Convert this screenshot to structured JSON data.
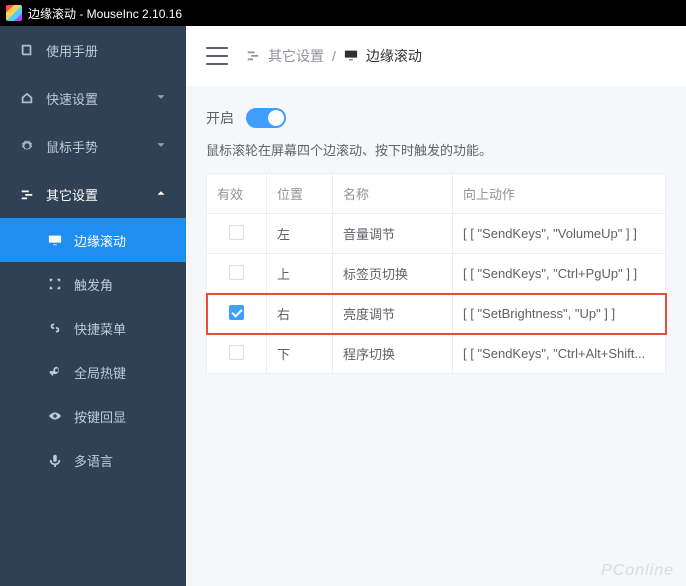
{
  "window": {
    "title": "边缘滚动 - MouseInc 2.10.16"
  },
  "sidebar": {
    "items": [
      {
        "label": "使用手册"
      },
      {
        "label": "快速设置"
      },
      {
        "label": "鼠标手势"
      }
    ],
    "group": {
      "label": "其它设置",
      "children": [
        {
          "label": "边缘滚动"
        },
        {
          "label": "触发角"
        },
        {
          "label": "快捷菜单"
        },
        {
          "label": "全局热键"
        },
        {
          "label": "按键回显"
        },
        {
          "label": "多语言"
        }
      ]
    }
  },
  "breadcrumb": {
    "parent": "其它设置",
    "current": "边缘滚动",
    "sep": "/"
  },
  "page": {
    "toggle_label": "开启",
    "desc": "鼠标滚轮在屏幕四个边滚动、按下时触发的功能。",
    "columns": {
      "enabled": "有效",
      "position": "位置",
      "name": "名称",
      "up_action": "向上动作"
    },
    "rows": [
      {
        "enabled": false,
        "position": "左",
        "name": "音量调节",
        "up_action": "[ [ \"SendKeys\", \"VolumeUp\" ] ]"
      },
      {
        "enabled": false,
        "position": "上",
        "name": "标签页切换",
        "up_action": "[ [ \"SendKeys\", \"Ctrl+PgUp\" ] ]"
      },
      {
        "enabled": true,
        "position": "右",
        "name": "亮度调节",
        "up_action": "[ [ \"SetBrightness\", \"Up\" ] ]",
        "highlight": true
      },
      {
        "enabled": false,
        "position": "下",
        "name": "程序切换",
        "up_action": "[ [ \"SendKeys\", \"Ctrl+Alt+Shift..."
      }
    ]
  },
  "watermark": "PConline"
}
